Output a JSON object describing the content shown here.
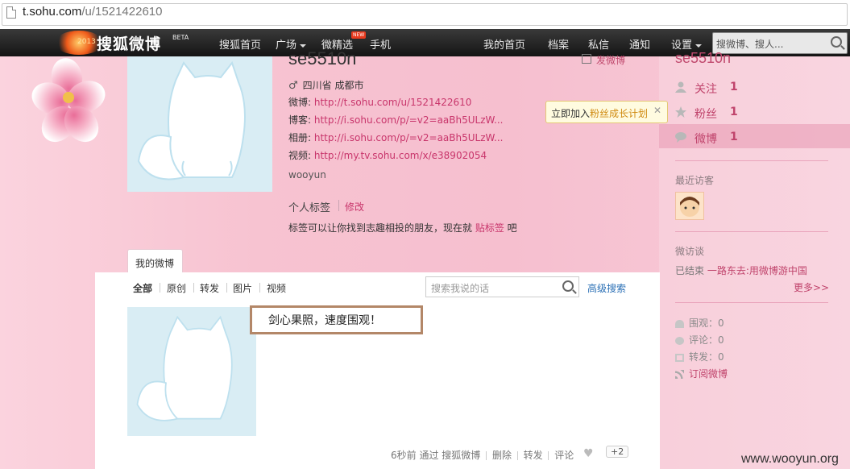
{
  "browser": {
    "url_host": "t.sohu.com",
    "url_path": "/u/1521422610"
  },
  "nav": {
    "logo_year": "2013",
    "brand": "搜狐微博",
    "beta": "BETA",
    "items": [
      "搜狐首页",
      "广场",
      "微精选",
      "手机"
    ],
    "new_badge": "NEW",
    "right_items": [
      "我的首页",
      "档案",
      "私信",
      "通知",
      "设置"
    ],
    "search_placeholder": "搜微博、搜人..."
  },
  "profile": {
    "username": "se5510n",
    "post_link": "发微博",
    "gender_symbol": "♂",
    "location": "四川省 成都市",
    "rows": [
      {
        "label": "微博:",
        "value": "http://t.sohu.com/u/1521422610"
      },
      {
        "label": "博客:",
        "value": "http://i.sohu.com/p/=v2=aaBh5ULzW..."
      },
      {
        "label": "相册:",
        "value": "http://i.sohu.com/p/=v2=aaBh5ULzW..."
      },
      {
        "label": "视频:",
        "value": "http://my.tv.sohu.com/x/e38902054"
      }
    ],
    "bio": "wooyun",
    "tags_title": "个人标签",
    "tags_edit": "修改",
    "tags_hint_prefix": "标签可以让你找到志趣相投的朋友，现在就 ",
    "tags_hint_link": "贴标签",
    "tags_hint_suffix": " 吧"
  },
  "tabs": {
    "my_weibo": "我的微博"
  },
  "feed": {
    "filters": [
      "全部",
      "原创",
      "转发",
      "图片",
      "视频"
    ],
    "search_placeholder": "搜索我说的话",
    "advanced_search": "高级搜索",
    "post_text": "剑心果照，速度围观！",
    "meta_time": "6秒前",
    "meta_via": "通过 搜狐微博",
    "actions": [
      "删除",
      "转发",
      "评论"
    ],
    "plus_count": "+2"
  },
  "sidebar": {
    "name": "se5510n",
    "stats": [
      {
        "label": "关注",
        "count": "1"
      },
      {
        "label": "粉丝",
        "count": "1"
      },
      {
        "label": "微博",
        "count": "1"
      }
    ],
    "tooltip_prefix": "立即加入",
    "tooltip_link": "粉丝成长计划",
    "tooltip_close": "✕",
    "recent_visitors": "最近访客",
    "micro_talk": "微访谈",
    "talk_status": "已结束",
    "talk_title": "一路东去:用微博游中国",
    "more": "更多>>",
    "views": "围观：0",
    "comments": "评论：0",
    "reposts": "转发：0",
    "subscribe": "订阅微博"
  },
  "watermark": "www.wooyun.org",
  "colors": {
    "accent_pink": "#c0446c",
    "link_blue": "#2a6fb5",
    "nav_bg": "#1f1f1f"
  }
}
